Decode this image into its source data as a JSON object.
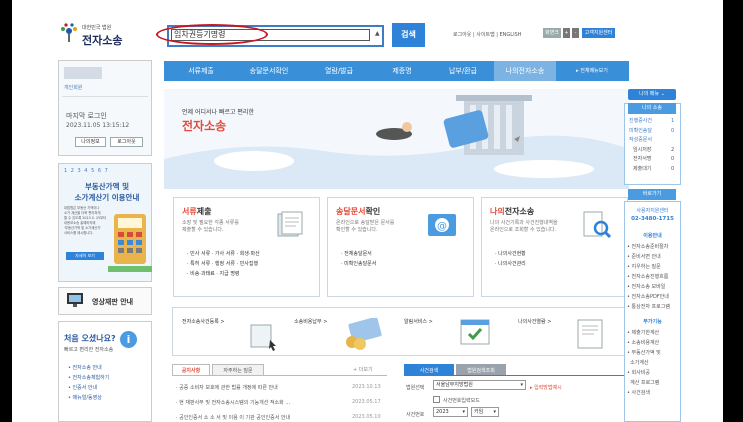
{
  "header": {
    "logo_sub": "대한민국 법원",
    "logo_main": "전자소송",
    "search_value": "임차권등기명령",
    "search_button": "검색",
    "top_links": "로그아웃 | 사이트맵 | ENGLISH",
    "btn_reset": "화면크기",
    "btn_plus": "+",
    "btn_minus": "-",
    "btn_remote": "고객지원센터"
  },
  "nav": {
    "items": [
      "서류제출",
      "송달문서확인",
      "열람/발급",
      "제증명",
      "납부/환급",
      "나의전자소송"
    ],
    "all_menu": "▸ 전체메뉴보기"
  },
  "login": {
    "member": "개인회원",
    "last_login_label": "마지막 로그인",
    "last_login_time": "2023.11.05 13:15:12",
    "my_info": "나의정보",
    "logout": "로그아웃"
  },
  "banner_left": {
    "pager": "1 2 3 4 5 6 7",
    "title": "부동산가액 및\n소가계산기 이용안내",
    "desc": "대법원은 부동산 가액이나\n소가 계산을 더욱 편리하게\n할 수 있도록 2015.5. 25부터\n내용보소송 홍예하지에\n'부동산가액 및 소가계산기'\n서비스를 제시합니다.",
    "detail": "자세히 보기"
  },
  "video": {
    "label": "영상재판 안내"
  },
  "first_visit": {
    "title": "처음 오셨나요?",
    "subtitle": "빠르고 편리한 전자소송",
    "links": [
      "• 전자소송 안내",
      "• 전자소송체험하기",
      "• 인증서 안내",
      "• 매뉴얼/동영상"
    ]
  },
  "hero": {
    "sub": "언제 어디서나 빠르고 편리한",
    "title": "전자소송"
  },
  "cards": [
    {
      "title_a": "서류",
      "title_b": "제출",
      "desc": "소장 및 필요한 각종 서류를\n제출할 수 있습니다.",
      "list": [
        "· 민사 서류 · 가사 서류 · 회생·파산",
        "· 특허 서류 · 행정 서류 · 민사집행",
        "· 비송·과태료 · 지급 명령"
      ]
    },
    {
      "title_a": "송달문서",
      "title_b": "확인",
      "desc": "온라인으로 송달받은 문서를\n확인할 수 있습니다.",
      "list": [
        "· 전체송달문서",
        "· 미확인송달문서"
      ]
    },
    {
      "title_a": "나의",
      "title_b": "전자소송",
      "desc": "나의 사건기록과 사건진행내역을\n온라인으로 조회할 수 있습니다.",
      "list": [
        "· 나의사건현황",
        "· 나의사건관리"
      ]
    }
  ],
  "quick": {
    "items": [
      "전자소송사건등록 >",
      "소송비용납부 >",
      "알림서비스 >",
      "나의사건열람 >"
    ]
  },
  "notice": {
    "tab_notice": "공지사항",
    "tab_faq": "자주하는 질문",
    "more": "+ 더보기",
    "rows": [
      {
        "text": "· 공증 소비자 보호에 관한 법률 개정에 따른 안내",
        "date": "2023.10.13"
      },
      {
        "text": "· 현 재판사무 및 전자소송시스템의 기능개선 적소화 ...",
        "date": "2023.05.17"
      },
      {
        "text": "· 공인인증서 소 소 서 및 이용 이 기관 공인인증서 안내",
        "date": "2023.05.10"
      }
    ]
  },
  "case_search": {
    "tab1": "사건검색",
    "tab2": "법원검색조회",
    "court_label": "법원선택",
    "court_value": "서울남부지방법원",
    "direct": "▸ 입력방법예시",
    "checkbox": "사건번호입력모드",
    "case_label": "사건번호",
    "year": "2023",
    "type": "카임"
  },
  "right": {
    "my_menu": "나의 메뉴 ⌄",
    "my_case": "나의 소송",
    "rows": [
      {
        "label": "진행중사건",
        "value": "1"
      },
      {
        "label": "미확인송달",
        "value": "0"
      },
      {
        "label": "작성중문서",
        "value": ""
      },
      {
        "label": "임시저장",
        "value": "2"
      },
      {
        "label": "전자서명",
        "value": "0"
      },
      {
        "label": "제출대기",
        "value": "0"
      }
    ],
    "shortcut": "바로가기",
    "center": "사용자지원센터",
    "phone": "02-3480-1715",
    "guide_title": "이용안내",
    "guide": [
      "• 전자소송준비절차",
      "• 준비서면 안내",
      "• 지우하는 질문",
      "• 전자소송진행흐름",
      "• 전자소송 모바일",
      "• 전자소송PDF안내",
      "• 통상전자 프로그램"
    ],
    "related_title": "부가기능",
    "related": [
      "• 제출기한계산",
      "• 소송비용계산",
      "• 부동산가액 및",
      "  소가계산",
      "• 회사비공",
      "  계산 프로그램",
      "• 사건검색"
    ]
  },
  "colors": {
    "accent": "#2e82d8",
    "highlight_ring": "#c8151f",
    "hero_title": "#e54b3b"
  }
}
